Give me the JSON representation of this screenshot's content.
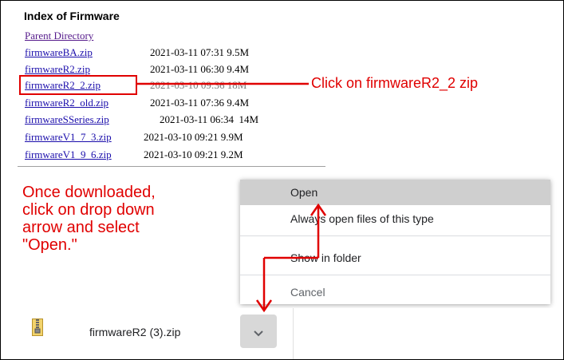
{
  "listing": {
    "title": "Index of Firmware",
    "parent_link": "Parent Directory",
    "files": [
      {
        "name": "firmwareBA.zip",
        "meta": "2021-03-11 07:31 9.5M"
      },
      {
        "name": "firmwareR2.zip",
        "meta": "2021-03-11 06:30 9.4M"
      },
      {
        "name": "firmwareR2_2.zip",
        "meta": "2021-03-10 09:36 18M"
      },
      {
        "name": "firmwareR2_old.zip",
        "meta": "2021-03-11 07:36 9.4M"
      },
      {
        "name": "firmwareSSeries.zip",
        "meta": "2021-03-11 06:34  14M"
      },
      {
        "name": "firmwareV1_7_3.zip",
        "meta": "2021-03-10 09:21 9.9M"
      },
      {
        "name": "firmwareV1_9_6.zip",
        "meta": "2021-03-10 09:21 9.2M"
      }
    ]
  },
  "annotations": {
    "callout": "Click on firmwareR2_2 zip",
    "instruction": "Once downloaded,\nclick on drop down\narrow and select\n\"Open.\"",
    "color": "#e00000"
  },
  "context_menu": {
    "open": "Open",
    "always_open": "Always open files of this type",
    "show_in_folder": "Show in folder",
    "cancel": "Cancel"
  },
  "download_shelf": {
    "file_name": "firmwareR2 (3).zip",
    "icon": "zip-file-icon"
  }
}
